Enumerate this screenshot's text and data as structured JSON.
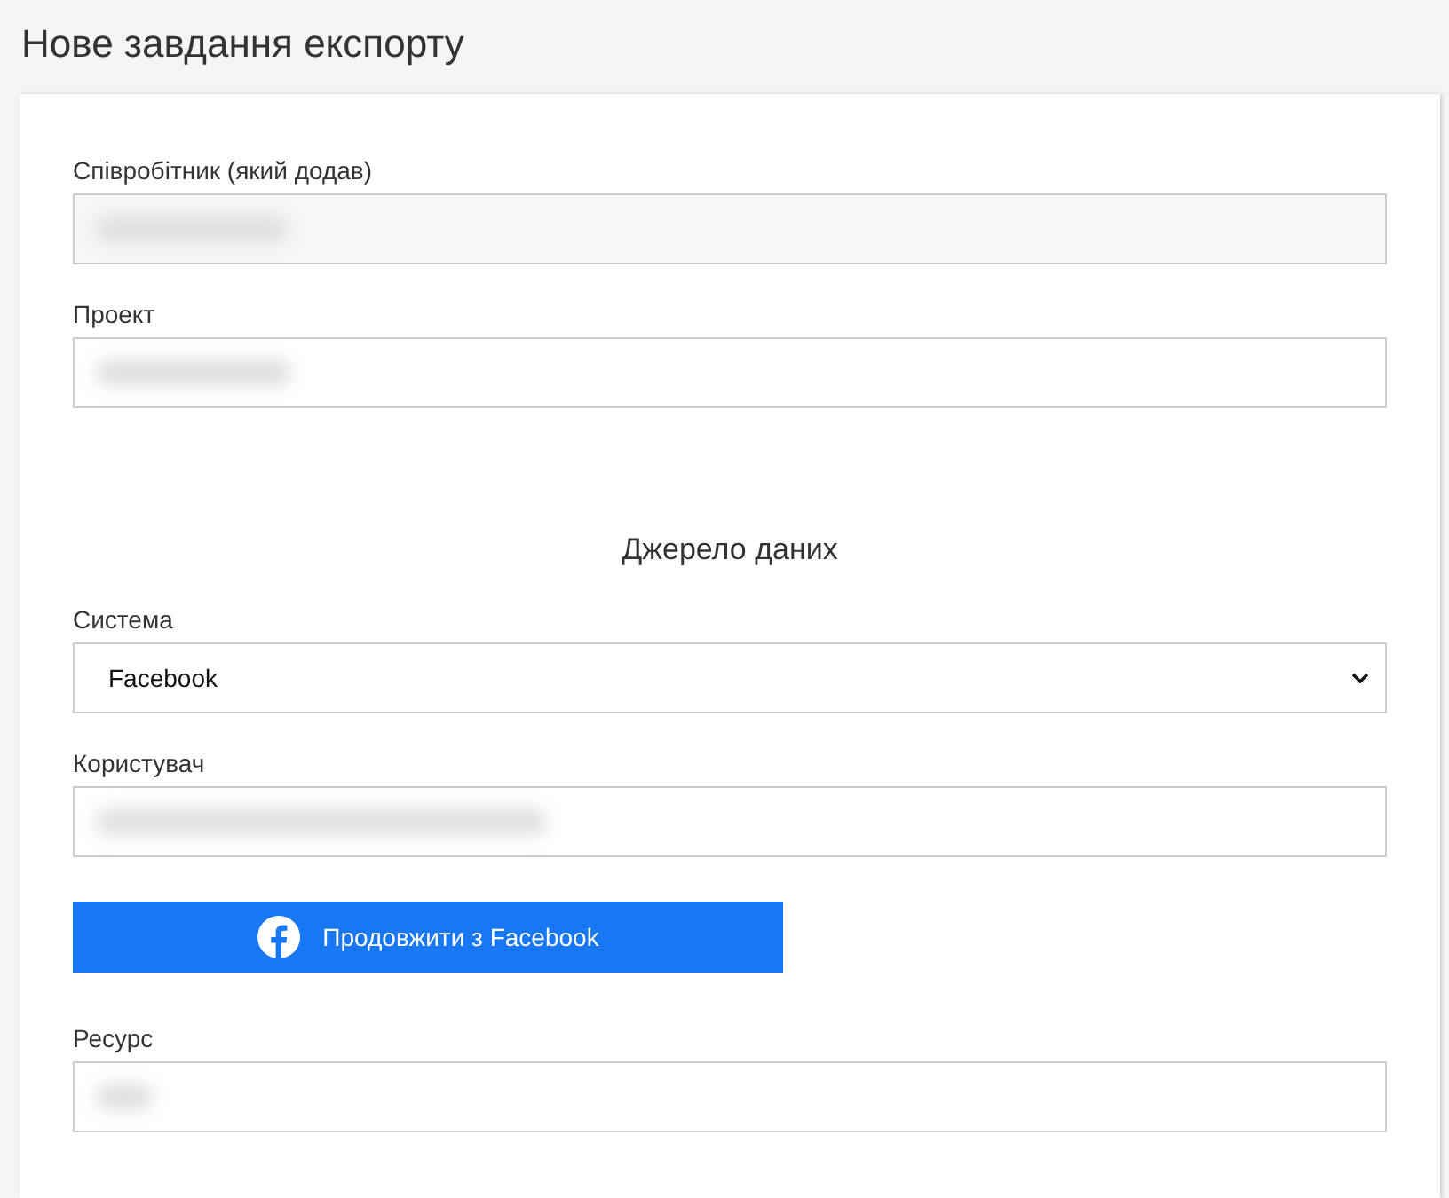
{
  "title": "Нове завдання експорту",
  "form": [
    {
      "kind": "readonly_field",
      "label": "Співробітник (який додав)",
      "redacted": true
    },
    {
      "kind": "field",
      "label": "Проект",
      "redacted": true
    },
    {
      "kind": "heading",
      "text": "Джерело даних"
    },
    {
      "kind": "select",
      "label": "Система",
      "value": "Facebook"
    },
    {
      "kind": "field",
      "label": "Користувач",
      "redacted": true
    },
    {
      "kind": "button",
      "label": "Продовжити з Facebook"
    },
    {
      "kind": "field",
      "label": "Ресурс",
      "redacted": true
    }
  ]
}
